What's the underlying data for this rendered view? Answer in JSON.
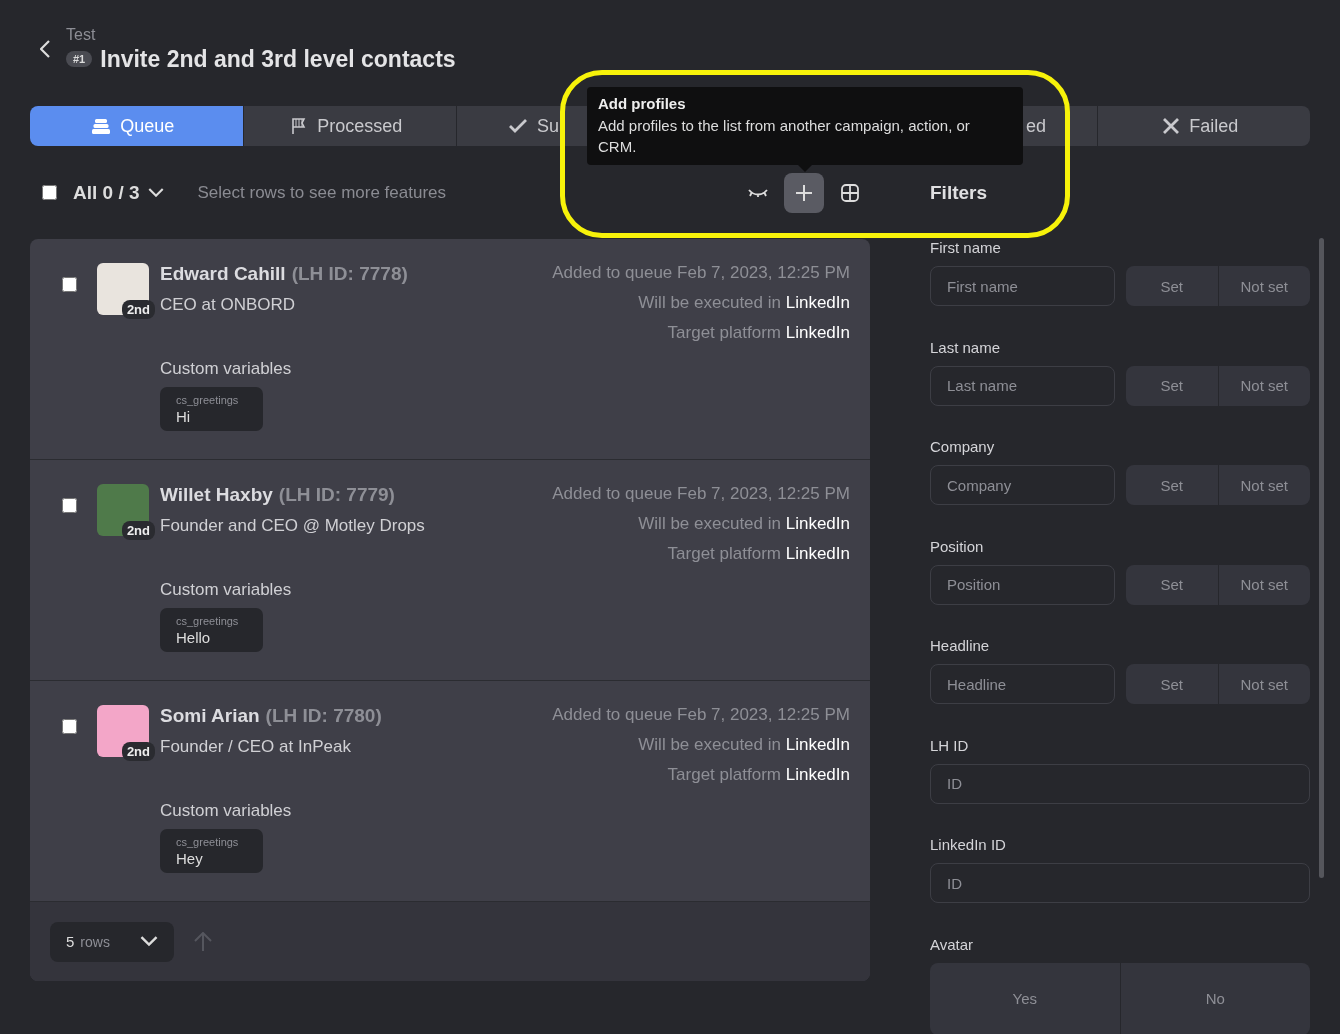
{
  "header": {
    "subtitle": "Test",
    "badge": "#1",
    "title": "Invite 2nd and 3rd level contacts"
  },
  "tabs": [
    {
      "label": "Queue",
      "selected": true
    },
    {
      "label": "Processed",
      "selected": false
    },
    {
      "label": "Su",
      "selected": false
    },
    {
      "label": "ed",
      "selected": false
    },
    {
      "label": "Failed",
      "selected": false
    }
  ],
  "toolbar": {
    "select_all": {
      "checked": false,
      "label": "All 0 / 3"
    },
    "hint": "Select rows to see more features"
  },
  "tooltip": {
    "title": "Add profiles",
    "text": "Add profiles to the list from another campaign, action, or CRM."
  },
  "rows": [
    {
      "checked": false,
      "degree": "2nd",
      "name": "Edward Cahill",
      "lh_id": "(LH ID: 7778)",
      "headline": "CEO at ONBORD",
      "added": "Added to queue Feb 7, 2023, 12:25 PM",
      "executed_label": "Will be executed in",
      "executed_value": "LinkedIn",
      "target_label": "Target platform",
      "target_value": "LinkedIn",
      "variables_title": "Custom variables",
      "variables": [
        {
          "key": "cs_greetings",
          "value": "Hi"
        }
      ]
    },
    {
      "checked": false,
      "degree": "2nd",
      "name": "Willet Haxby",
      "lh_id": "(LH ID: 7779)",
      "headline": "Founder and CEO @ Motley Drops",
      "added": "Added to queue Feb 7, 2023, 12:25 PM",
      "executed_label": "Will be executed in",
      "executed_value": "LinkedIn",
      "target_label": "Target platform",
      "target_value": "LinkedIn",
      "variables_title": "Custom variables",
      "variables": [
        {
          "key": "cs_greetings",
          "value": "Hello"
        }
      ]
    },
    {
      "checked": false,
      "degree": "2nd",
      "name": "Somi Arian",
      "lh_id": "(LH ID: 7780)",
      "headline": "Founder / CEO at InPeak",
      "added": "Added to queue Feb 7, 2023, 12:25 PM",
      "executed_label": "Will be executed in",
      "executed_value": "LinkedIn",
      "target_label": "Target platform",
      "target_value": "LinkedIn",
      "variables_title": "Custom variables",
      "variables": [
        {
          "key": "cs_greetings",
          "value": "Hey"
        }
      ]
    }
  ],
  "footer": {
    "rows_count": "5",
    "rows_label": "rows"
  },
  "filters": {
    "title": "Filters",
    "items": [
      {
        "kind": "text_set",
        "label": "First name",
        "placeholder": "First name",
        "options": [
          "Set",
          "Not set"
        ]
      },
      {
        "kind": "text_set",
        "label": "Last name",
        "placeholder": "Last name",
        "options": [
          "Set",
          "Not set"
        ]
      },
      {
        "kind": "text_set",
        "label": "Company",
        "placeholder": "Company",
        "options": [
          "Set",
          "Not set"
        ]
      },
      {
        "kind": "text_set",
        "label": "Position",
        "placeholder": "Position",
        "options": [
          "Set",
          "Not set"
        ]
      },
      {
        "kind": "text_set",
        "label": "Headline",
        "placeholder": "Headline",
        "options": [
          "Set",
          "Not set"
        ]
      },
      {
        "kind": "text",
        "label": "LH ID",
        "placeholder": "ID"
      },
      {
        "kind": "text",
        "label": "LinkedIn ID",
        "placeholder": "ID"
      },
      {
        "kind": "choice",
        "label": "Avatar",
        "options": [
          "Yes",
          "No"
        ]
      }
    ]
  }
}
